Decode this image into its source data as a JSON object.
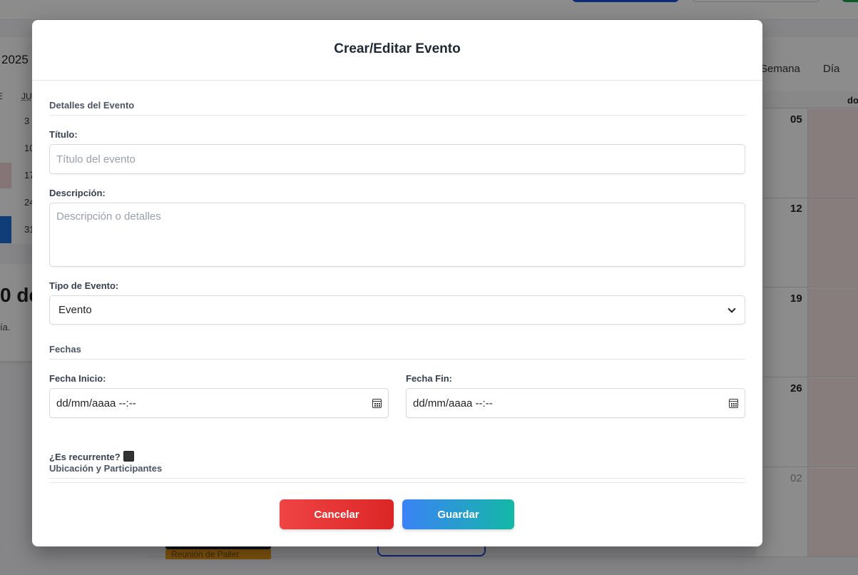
{
  "background": {
    "year": "2025",
    "weekday_head": "JU",
    "weekday_head_prev": "E",
    "mini_days": [
      "3",
      "10",
      "17",
      "24",
      "31"
    ],
    "big_text": "0 de",
    "small_text": "ía.",
    "view_week": "Semana",
    "view_day": "Día",
    "col_header": "do",
    "week_numbers": [
      "05",
      "12",
      "19",
      "26",
      "02"
    ],
    "event_label": "Reunión de Pallet"
  },
  "modal": {
    "title": "Crear/Editar Evento",
    "sections": {
      "details": "Detalles del Evento",
      "dates": "Fechas",
      "location": "Ubicación y Participantes"
    },
    "fields": {
      "title_label": "Título:",
      "title_placeholder": "Título del evento",
      "title_value": "",
      "description_label": "Descripción:",
      "description_placeholder": "Descripción o detalles",
      "description_value": "",
      "type_label": "Tipo de Evento:",
      "type_selected": "Evento",
      "start_label": "Fecha Inicio:",
      "start_value": "dd/mm/aaaa --:--",
      "end_label": "Fecha Fin:",
      "end_value": "dd/mm/aaaa --:--",
      "recurring_label": "¿Es recurrente?"
    },
    "buttons": {
      "cancel": "Cancelar",
      "save": "Guardar"
    }
  },
  "colors": {
    "cancel_start": "#ef4444",
    "cancel_end": "#dc2626",
    "save_start": "#3b82f6",
    "save_end": "#14b8a6"
  },
  "icons": {
    "date_picker": "calendar-icon",
    "select": "chevron-down-icon"
  }
}
